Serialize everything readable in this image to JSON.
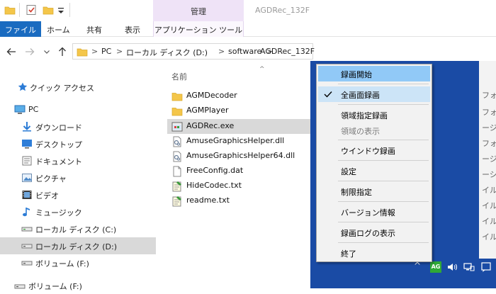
{
  "window": {
    "title": "AGDRec_132F",
    "context_tab": "管理"
  },
  "ribbon": {
    "tabs": [
      "ファイル",
      "ホーム",
      "共有",
      "表示",
      "アプリケーション ツール"
    ]
  },
  "address": {
    "crumbs": [
      "PC",
      "ローカル ディスク (D:)",
      "software",
      "AGDRec_132F"
    ],
    "separator": ">"
  },
  "sidebar": {
    "items": [
      {
        "label": "クイック アクセス",
        "icon": "star-icon"
      },
      {
        "label": "PC",
        "icon": "pc-icon"
      },
      {
        "label": "ダウンロード",
        "icon": "download-icon"
      },
      {
        "label": "デスクトップ",
        "icon": "desktop-icon"
      },
      {
        "label": "ドキュメント",
        "icon": "document-icon"
      },
      {
        "label": "ピクチャ",
        "icon": "picture-icon"
      },
      {
        "label": "ビデオ",
        "icon": "video-icon"
      },
      {
        "label": "ミュージック",
        "icon": "music-icon"
      },
      {
        "label": "ローカル ディスク (C:)",
        "icon": "drive-icon"
      },
      {
        "label": "ローカル ディスク (D:)",
        "icon": "drive-icon",
        "selected": true
      },
      {
        "label": "ボリューム (F:)",
        "icon": "drive-icon"
      },
      {
        "label": "ボリューム (F:)",
        "icon": "drive-icon"
      }
    ]
  },
  "filelist": {
    "column_name": "名前",
    "sort_arrow": "^",
    "files": [
      {
        "name": "AGMDecoder",
        "type": "folder"
      },
      {
        "name": "AGMPlayer",
        "type": "folder"
      },
      {
        "name": "AGDRec.exe",
        "type": "exe",
        "selected": true
      },
      {
        "name": "AmuseGraphicsHelper.dll",
        "type": "dll"
      },
      {
        "name": "AmuseGraphicsHelper64.dll",
        "type": "dll"
      },
      {
        "name": "FreeConfig.dat",
        "type": "file"
      },
      {
        "name": "HideCodec.txt",
        "type": "txt"
      },
      {
        "name": "readme.txt",
        "type": "txt"
      }
    ]
  },
  "context_menu": {
    "items": [
      {
        "label": "録画開始",
        "state": "hover"
      },
      {
        "label": "全画面録画",
        "state": "checked"
      },
      {
        "label": "領域指定録画",
        "state": "normal"
      },
      {
        "label": "領域の表示",
        "state": "disabled"
      },
      {
        "label": "ウインドウ録画",
        "state": "normal"
      },
      {
        "label": "設定",
        "state": "normal"
      },
      {
        "label": "制限指定",
        "state": "normal"
      },
      {
        "label": "バージョン情報",
        "state": "normal"
      },
      {
        "label": "録画ログの表示",
        "state": "normal"
      },
      {
        "label": "終了",
        "state": "normal"
      }
    ]
  },
  "right_panel": {
    "snippets": [
      "フォ",
      "フォ",
      "ージ",
      "フォ",
      "ージ",
      "ーシ",
      "イル",
      "イル",
      "イル",
      "イル"
    ]
  },
  "tray": {
    "app_badge": "AG",
    "chevron": "^"
  },
  "colors": {
    "accent": "#1a6bc0",
    "desktop": "#1a4ba5",
    "menu_hover": "#91c9f7",
    "manage_tab": "#efe3f7",
    "selection": "#d9d9d9"
  }
}
